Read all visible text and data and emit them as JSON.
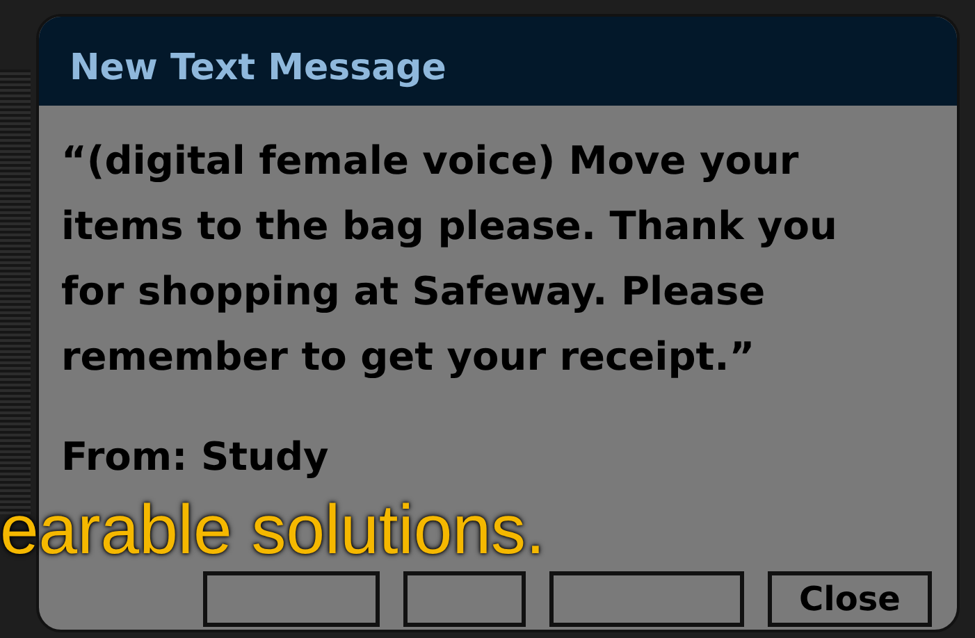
{
  "dialog": {
    "title": "New Text Message",
    "message": "“(digital female voice) Move your items to the bag please. Thank you for shopping at Safeway. Please remember to get your receipt.”",
    "sender": "From: Study",
    "buttons": [
      {
        "kind": "covered"
      },
      {
        "kind": "covered"
      },
      {
        "kind": "covered"
      },
      {
        "kind": "labeled",
        "label": "Close"
      }
    ]
  },
  "subtitle": "earable solutions."
}
